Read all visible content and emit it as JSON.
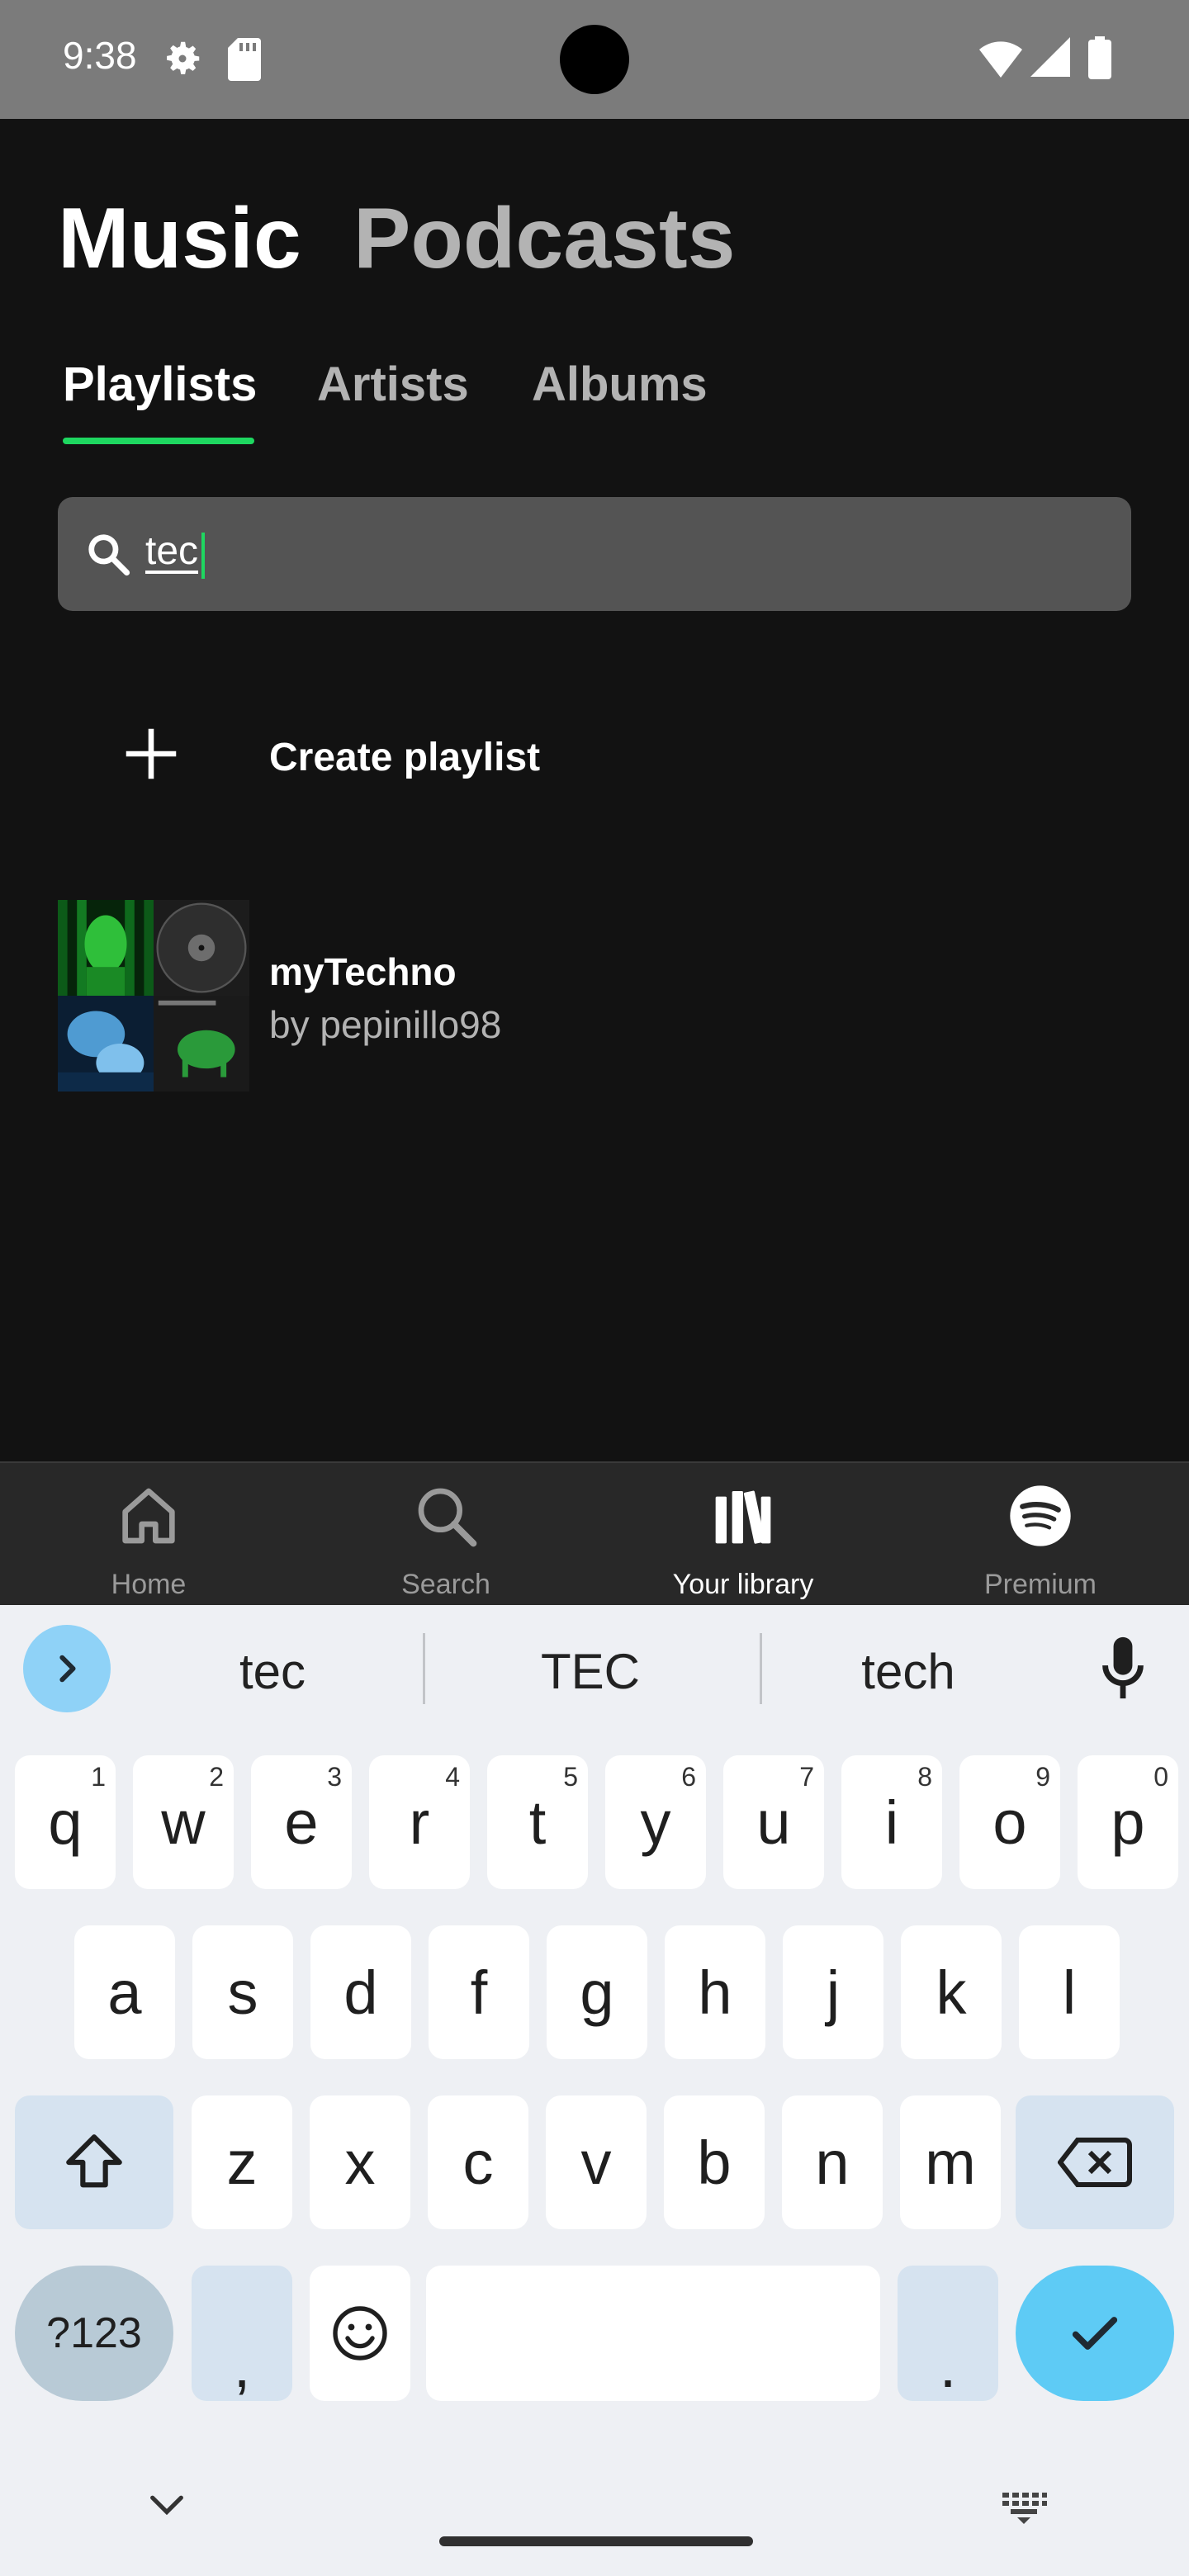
{
  "status": {
    "time": "9:38"
  },
  "header": {
    "music": "Music",
    "podcasts": "Podcasts"
  },
  "tabs": {
    "playlists": "Playlists",
    "artists": "Artists",
    "albums": "Albums"
  },
  "search": {
    "value": "tec"
  },
  "create": {
    "label": "Create playlist"
  },
  "playlist": {
    "name": "myTechno",
    "owner": "by pepinillo98"
  },
  "nav": {
    "home": "Home",
    "search": "Search",
    "library": "Your library",
    "premium": "Premium"
  },
  "keyboard": {
    "suggestions": [
      "tec",
      "TEC",
      "tech"
    ],
    "row1": [
      {
        "k": "q",
        "n": "1"
      },
      {
        "k": "w",
        "n": "2"
      },
      {
        "k": "e",
        "n": "3"
      },
      {
        "k": "r",
        "n": "4"
      },
      {
        "k": "t",
        "n": "5"
      },
      {
        "k": "y",
        "n": "6"
      },
      {
        "k": "u",
        "n": "7"
      },
      {
        "k": "i",
        "n": "8"
      },
      {
        "k": "o",
        "n": "9"
      },
      {
        "k": "p",
        "n": "0"
      }
    ],
    "row2": [
      "a",
      "s",
      "d",
      "f",
      "g",
      "h",
      "j",
      "k",
      "l"
    ],
    "row3": [
      "z",
      "x",
      "c",
      "v",
      "b",
      "n",
      "m"
    ],
    "symbols": "?123",
    "comma": ",",
    "period": "."
  },
  "colors": {
    "accent": "#1ed760",
    "background": "#121212"
  }
}
